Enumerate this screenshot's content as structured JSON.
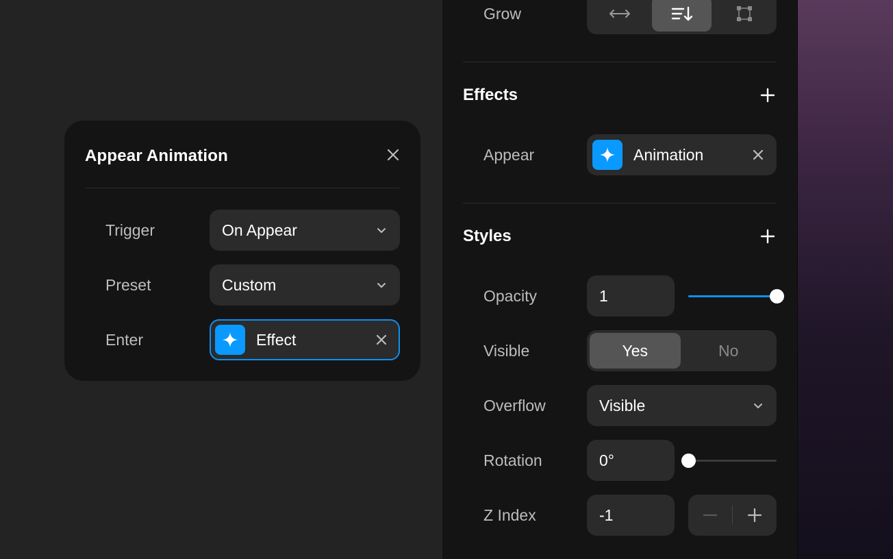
{
  "popover": {
    "title": "Appear Animation",
    "trigger": {
      "label": "Trigger",
      "value": "On Appear"
    },
    "preset": {
      "label": "Preset",
      "value": "Custom"
    },
    "enter": {
      "label": "Enter",
      "value": "Effect"
    }
  },
  "panel": {
    "grow": {
      "label": "Grow",
      "options": [
        "horizontal-arrows-icon",
        "align-sort-icon",
        "frame-icon"
      ],
      "selected_index": 1
    },
    "effects": {
      "title": "Effects",
      "appear": {
        "label": "Appear",
        "value": "Animation"
      }
    },
    "styles": {
      "title": "Styles",
      "opacity": {
        "label": "Opacity",
        "value": "1",
        "slider_level": 1.0
      },
      "visible": {
        "label": "Visible",
        "options": [
          "Yes",
          "No"
        ],
        "selected": "Yes"
      },
      "overflow": {
        "label": "Overflow",
        "value": "Visible"
      },
      "rotation": {
        "label": "Rotation",
        "value": "0°",
        "slider_level": 0.0
      },
      "zindex": {
        "label": "Z Index",
        "value": "-1"
      }
    }
  },
  "colors": {
    "accent": "#0a99ff",
    "focus_border": "#0e8ff0",
    "panel_bg": "#141414",
    "canvas_bg": "#232323",
    "control_bg": "#2b2b2b"
  }
}
